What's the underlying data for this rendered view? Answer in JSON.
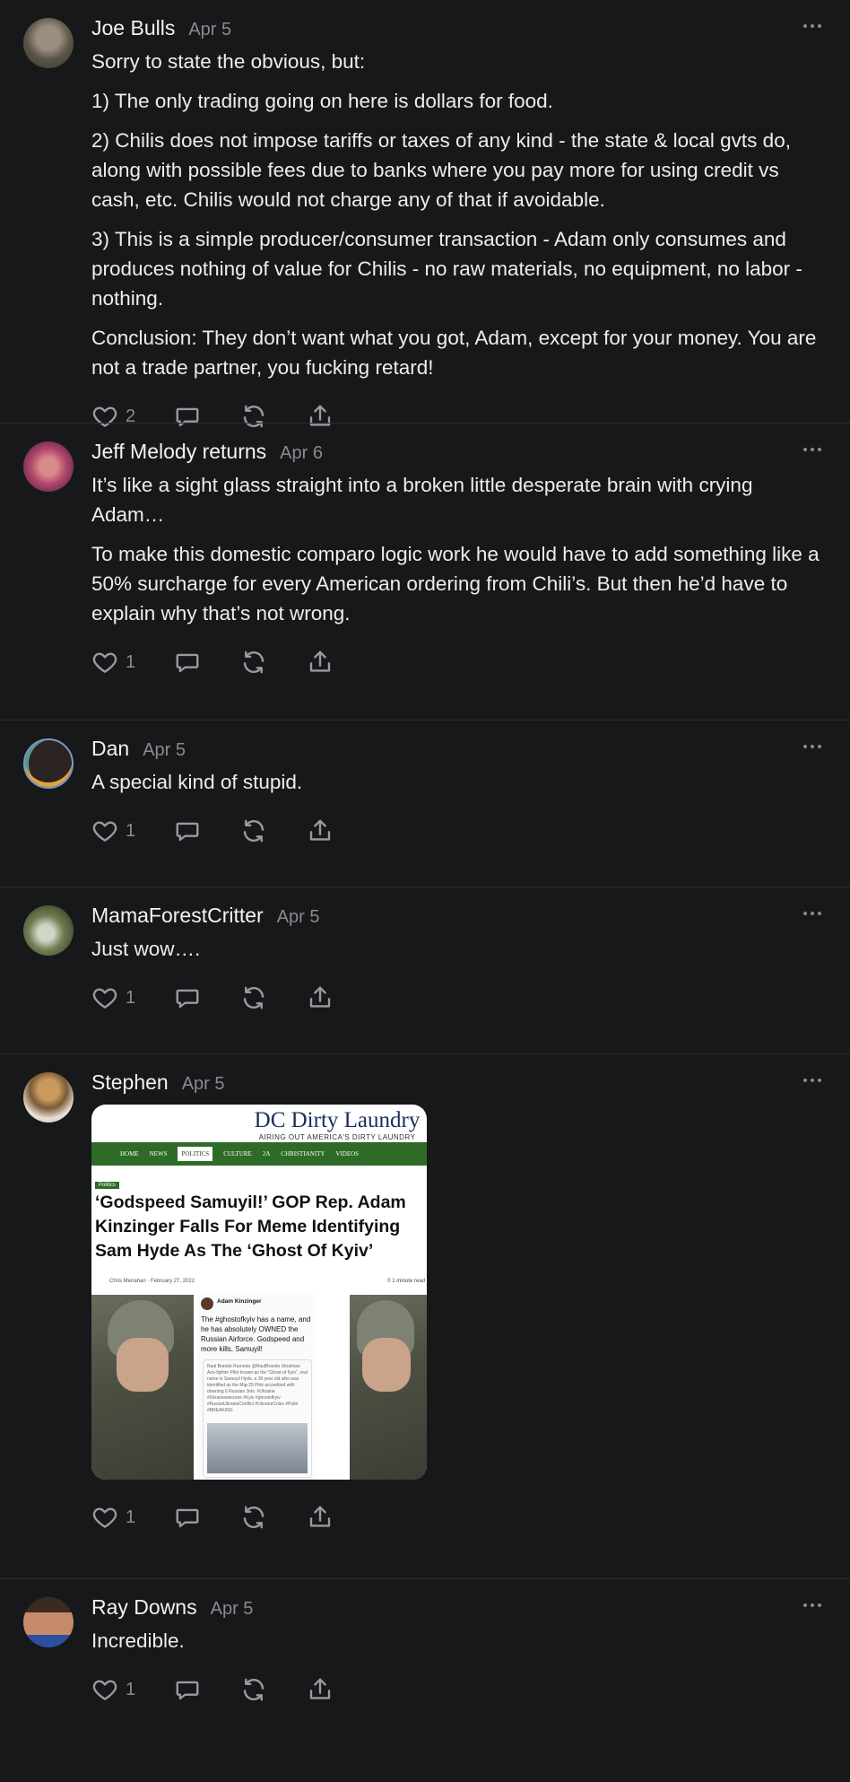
{
  "posts": [
    {
      "author": "Joe Bulls",
      "date": "Apr 5",
      "paragraphs": [
        "Sorry to state the obvious, but:",
        "1) The only trading going on here is dollars for food.",
        "2) Chilis does not impose tariffs or taxes of any kind - the state & local gvts do, along with possible fees due to banks where you pay more for using credit vs cash, etc. Chilis would not charge any of that if avoidable.",
        "3) This is a simple producer/consumer transaction - Adam only consumes and produces nothing of value for Chilis - no raw materials, no equipment, no labor - nothing.",
        "Conclusion: They don’t want what you got, Adam, except for your money. You are not a trade partner, you fucking retard!"
      ],
      "likes": "2"
    },
    {
      "author": "Jeff Melody returns",
      "date": "Apr 6",
      "paragraphs": [
        "It’s like a sight glass straight into a broken little desperate brain with crying Adam…",
        "To make this domestic comparo logic work he would have to add something like a 50% surcharge for every American ordering from Chili’s. But then he’d have to explain why that’s not wrong."
      ],
      "likes": "1"
    },
    {
      "author": "Dan",
      "date": "Apr 5",
      "paragraphs": [
        "A special kind of stupid."
      ],
      "likes": "1"
    },
    {
      "author": "MamaForestCritter",
      "date": "Apr 5",
      "paragraphs": [
        "Just wow…."
      ],
      "likes": "1"
    },
    {
      "author": "Stephen",
      "date": "Apr 5",
      "paragraphs": [],
      "likes": "1",
      "image": {
        "brand": "DC Dirty Laundry",
        "brand_sub": "AIRING OUT AMERICA'S DIRTY LAUNDRY",
        "nav": [
          "HOME",
          "NEWS",
          "POLITICS",
          "CULTURE",
          "2A",
          "CHRISTIANITY",
          "VIDEOS"
        ],
        "category": "Politics",
        "headline": "‘Godspeed Samuyil!’ GOP Rep. Adam Kinzinger Falls For Meme Identifying Sam Hyde As The ‘Ghost Of Kyiv’",
        "byline": "Chris Menahan · February 27, 2022",
        "meta": "0  1 minute read",
        "tweet_author": "Adam Kinzinger",
        "tweet_text": "The #ghostofkyiv has a name, and he has absolutely OWNED the Russian Airforce. Godspeed and more kills, Samuyil!",
        "tweet_quote": "Raul Brando Ramotar @RaulBrando Ukrainian Ace-fighter Pilot known as the \"Ghost of Kyiv\", real name is Samuyil Hyde, a 36 year old who was identified as the Mig-29 Pilot accredited with downing 6 Russian Jets. #Ukraine #Ukrainewarzone #Kyiv #ghostofkyiv #RussiaUkraineConflict #UkraineCrisis #Putin #BREAKING"
      }
    },
    {
      "author": "Ray Downs",
      "date": "Apr 5",
      "paragraphs": [
        "Incredible."
      ],
      "likes": "1"
    }
  ],
  "icons": [
    "heart-icon",
    "comment-icon",
    "restack-icon",
    "share-icon",
    "more-icon"
  ],
  "colors": {
    "background": "#17181a",
    "text": "#ececec",
    "muted": "#8a8b8f",
    "divider": "#2c2d30"
  }
}
